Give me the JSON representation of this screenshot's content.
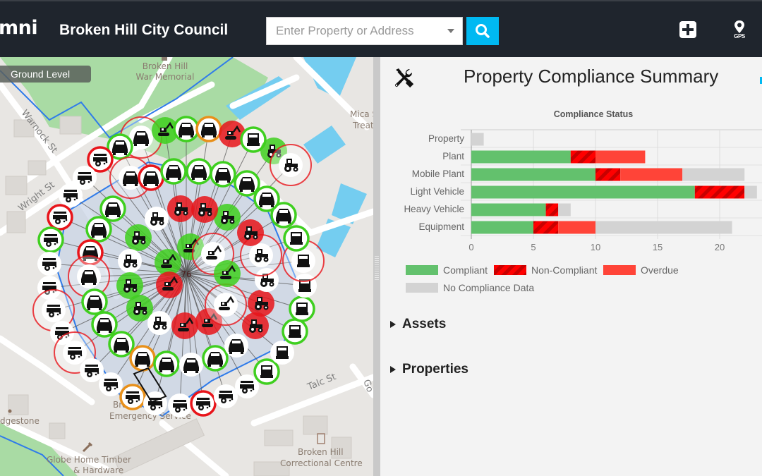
{
  "header": {
    "logo_text": "mni",
    "council_name": "Broken Hill City Council",
    "search": {
      "placeholder": "Enter Property or Address",
      "value": ""
    },
    "search_icon": "search-icon",
    "add_icon": "plus-square-icon",
    "gps_label": "GPS",
    "gps_icon": "map-pin-icon"
  },
  "map": {
    "level_button": "Ground Level",
    "cluster_count": "76",
    "place_labels": [
      {
        "id": "war-memorial",
        "lines": [
          "Broken Hill",
          "War Memorial"
        ]
      },
      {
        "id": "mica-st",
        "lines": [
          "Mica S",
          "Treat"
        ]
      },
      {
        "id": "emergency",
        "lines": [
          "Broken Hill",
          "Emergency Service"
        ]
      },
      {
        "id": "bridgestone",
        "lines": [
          "dgestone"
        ]
      },
      {
        "id": "globe-timber",
        "lines": [
          "Globe Home Timber",
          "& Hardware"
        ]
      },
      {
        "id": "correctional",
        "lines": [
          "Broken Hill",
          "Correctional Centre"
        ]
      }
    ],
    "street_labels": [
      "Warnock St",
      "Wright St",
      "Talc St",
      "Go"
    ],
    "status_colors": {
      "compliant": "#3fcf1f",
      "noncompliant": "#e8141a",
      "overdue": "#e8141a",
      "warning": "#e8901a"
    }
  },
  "panel": {
    "title": "Property Compliance Summary",
    "title_icon": "tools-icon",
    "sections": [
      {
        "label": "Assets",
        "expanded": false
      },
      {
        "label": "Properties",
        "expanded": false
      }
    ]
  },
  "chart_data": {
    "type": "bar",
    "orientation": "horizontal",
    "stacked": true,
    "title": "Compliance Status",
    "categories": [
      "Property",
      "Plant",
      "Mobile Plant",
      "Light Vehicle",
      "Heavy Vehicle",
      "Equipment"
    ],
    "series": [
      {
        "name": "Compliant",
        "color": "#63c16d",
        "values": [
          0,
          8,
          10,
          18,
          6,
          5
        ]
      },
      {
        "name": "Non-Compliant",
        "color": "#ff0000",
        "pattern": "diagonal-stripes",
        "stripe_color": "#cc0000",
        "values": [
          0,
          2,
          2,
          4,
          1,
          2
        ]
      },
      {
        "name": "Overdue",
        "color": "#ff4438",
        "values": [
          0,
          4,
          5,
          0,
          0,
          3
        ]
      },
      {
        "name": "No Compliance Data",
        "color": "#d3d3d3",
        "values": [
          1,
          0,
          5,
          1,
          1,
          11
        ]
      }
    ],
    "xlim": [
      0,
      23
    ],
    "xticks": [
      "0",
      "5",
      "10",
      "15",
      "20"
    ],
    "grid": true,
    "legend_position": "bottom"
  }
}
